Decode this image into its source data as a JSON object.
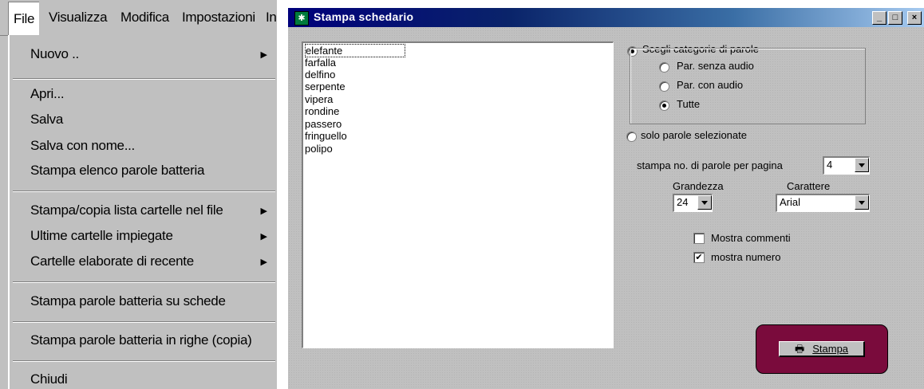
{
  "menubar": {
    "items": [
      "File",
      "Visualizza",
      "Modifica",
      "Impostazioni",
      "In"
    ]
  },
  "file_menu": {
    "items": [
      {
        "label": "Nuovo ..",
        "submenu": true
      },
      {
        "label": "Apri...",
        "submenu": false
      },
      {
        "label": "Salva",
        "submenu": false
      },
      {
        "label": "Salva con nome...",
        "submenu": false
      },
      {
        "label": "Stampa elenco parole batteria",
        "submenu": false
      },
      {
        "label": "Stampa/copia lista cartelle nel file",
        "submenu": true
      },
      {
        "label": "Ultime cartelle impiegate",
        "submenu": true
      },
      {
        "label": "Cartelle elaborate di recente",
        "submenu": true
      },
      {
        "label": "Stampa parole batteria su schede",
        "submenu": false
      },
      {
        "label": "Stampa parole batteria in righe (copia)",
        "submenu": false
      },
      {
        "label": "Chiudi",
        "submenu": false
      }
    ],
    "submenu_arrow": "▶"
  },
  "dialog": {
    "title": "Stampa schedario",
    "titlebar_buttons": [
      "_",
      "□",
      "×"
    ],
    "words": [
      "elefante",
      "farfalla",
      "delfino",
      "serpente",
      "vipera",
      "rondine",
      "passero",
      "fringuello",
      "polipo"
    ],
    "category_group": {
      "label": "Scegli categorie di parole",
      "options": [
        "Par. senza audio",
        "Par. con audio",
        "Tutte"
      ],
      "selected": "Tutte"
    },
    "selected_only_label": "solo parole selezionate",
    "words_per_page": {
      "label": "stampa no. di parole per pagina",
      "value": "4"
    },
    "size": {
      "label": "Grandezza",
      "value": "24"
    },
    "font": {
      "label": "Carattere",
      "value": "Arial"
    },
    "show_comments": {
      "label": "Mostra commenti",
      "checked": false
    },
    "show_number": {
      "label": "mostra numero",
      "checked": true
    },
    "print_button": {
      "label": "Stampa",
      "icon": "printer-icon"
    },
    "colors": {
      "titlebar_start": "#00007b",
      "titlebar_end": "#a6caf0",
      "print_panel": "#7a0b3c",
      "face": "#c0c0c0"
    }
  }
}
